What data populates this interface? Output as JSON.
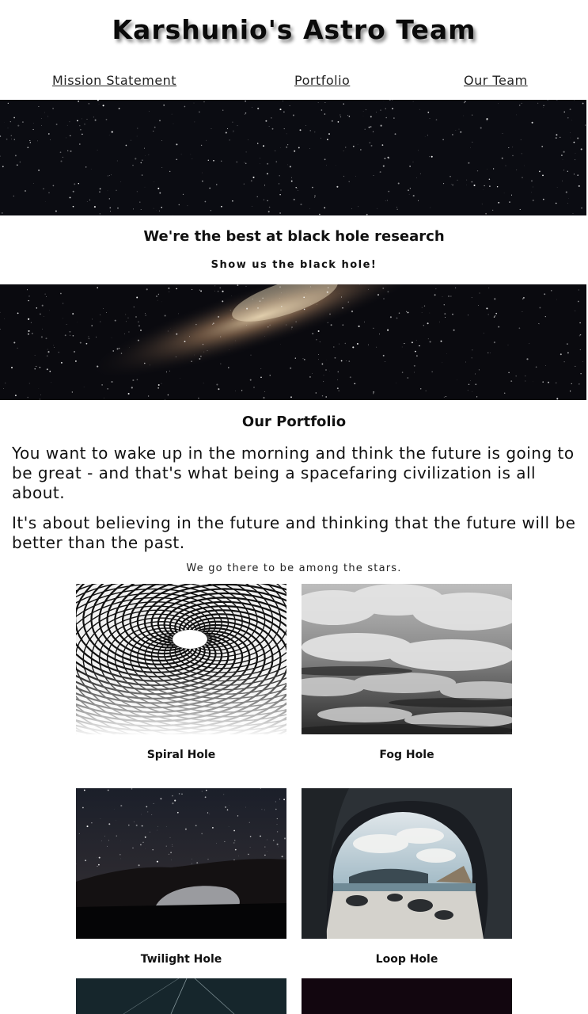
{
  "header": {
    "title": "Karshunio's Astro Team"
  },
  "nav": {
    "items": [
      {
        "label": "Mission Statement"
      },
      {
        "label": "Portfolio"
      },
      {
        "label": "Our Team"
      }
    ]
  },
  "hero": {
    "tagline": "We're the best at black hole research",
    "cta": "Show us the black hole!"
  },
  "portfolio": {
    "heading": "Our Portfolio",
    "paragraph_1": "You want to wake up in the morning and think the future is going to be great - and that's what being a spacefaring civilization is all about.",
    "paragraph_2": "It's about believing in the future and thinking that the future will be better than the past.",
    "note": "We go there to be among the stars.",
    "items": [
      {
        "caption": "Spiral Hole"
      },
      {
        "caption": "Fog Hole"
      },
      {
        "caption": "Twilight Hole"
      },
      {
        "caption": "Loop Hole"
      }
    ]
  },
  "colors": {
    "background": "#ffffff",
    "text": "#111111",
    "space": "#0b0b10"
  }
}
